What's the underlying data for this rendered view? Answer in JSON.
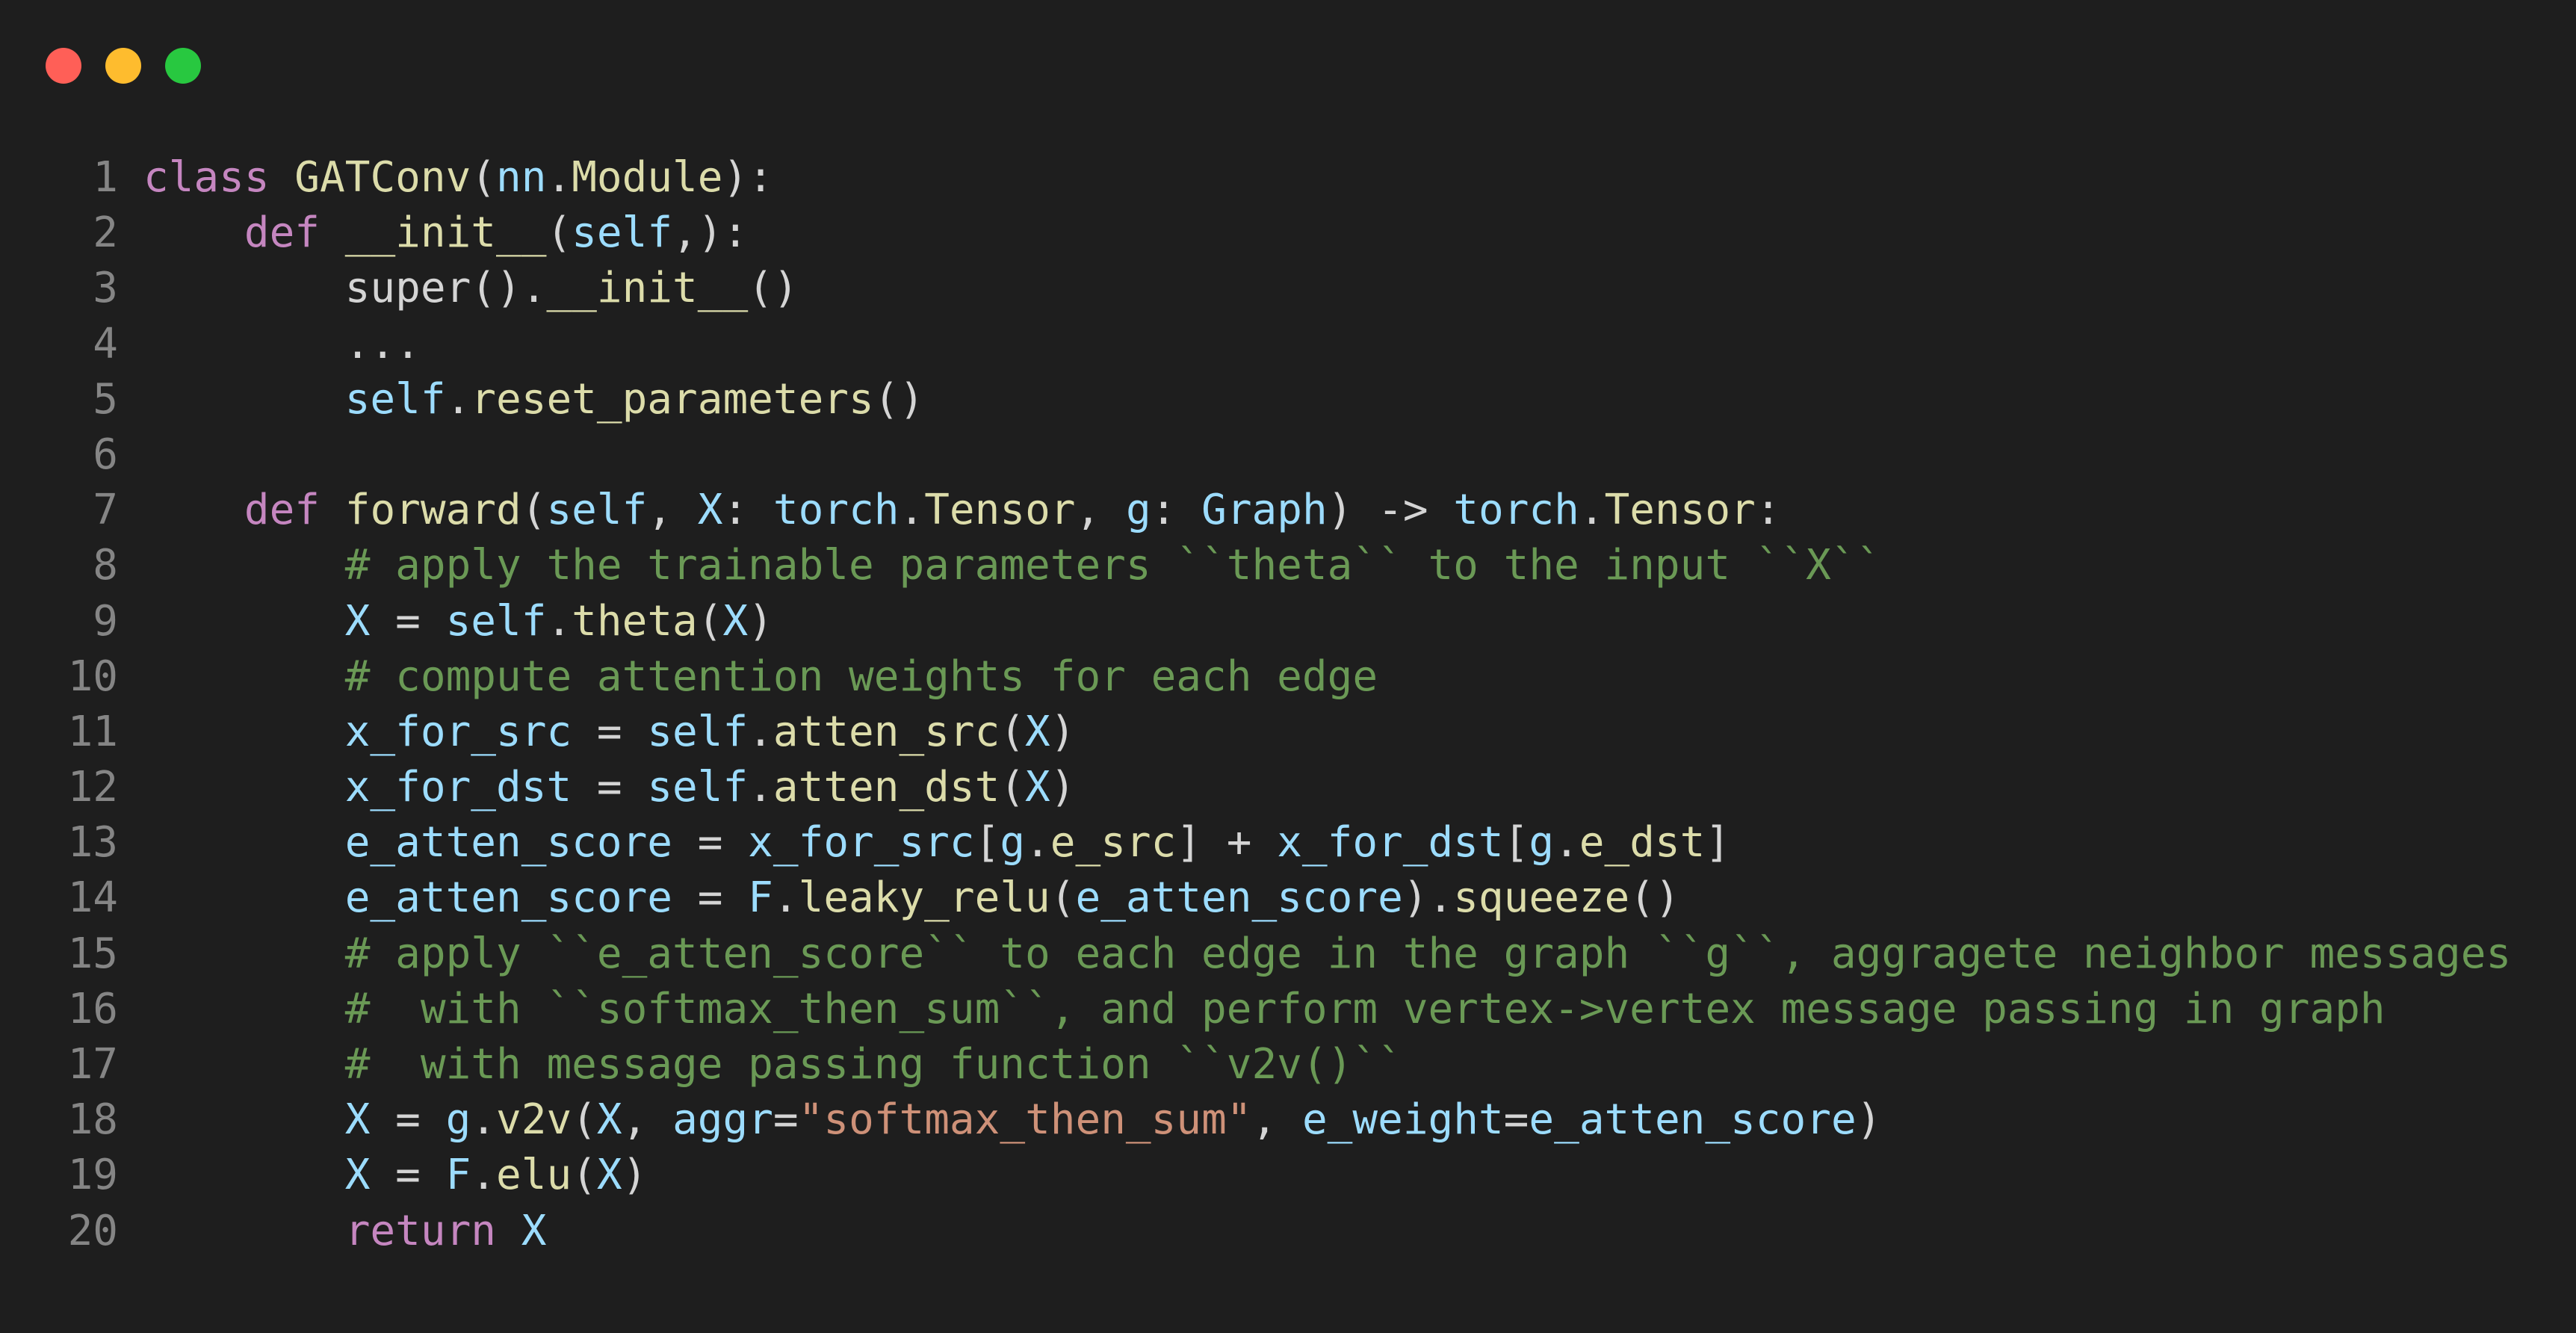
{
  "window": {
    "controls": [
      {
        "name": "close",
        "color": "#ff5f57"
      },
      {
        "name": "minimize",
        "color": "#febc2e"
      },
      {
        "name": "maximize",
        "color": "#28c840"
      }
    ]
  },
  "editor": {
    "language": "python",
    "lines": [
      {
        "n": "1",
        "tokens": [
          [
            "kw",
            "class"
          ],
          [
            "plain",
            " "
          ],
          [
            "cls",
            "GATConv"
          ],
          [
            "plain",
            "("
          ],
          [
            "var",
            "nn"
          ],
          [
            "plain",
            "."
          ],
          [
            "cls",
            "Module"
          ],
          [
            "plain",
            "):"
          ]
        ]
      },
      {
        "n": "2",
        "tokens": [
          [
            "plain",
            "    "
          ],
          [
            "def",
            "def"
          ],
          [
            "plain",
            " "
          ],
          [
            "fn",
            "__init__"
          ],
          [
            "plain",
            "("
          ],
          [
            "self",
            "self"
          ],
          [
            "plain",
            ",):"
          ]
        ]
      },
      {
        "n": "3",
        "tokens": [
          [
            "plain",
            "        super()."
          ],
          [
            "fn",
            "__init__"
          ],
          [
            "plain",
            "()"
          ]
        ]
      },
      {
        "n": "4",
        "tokens": [
          [
            "plain",
            "        ..."
          ]
        ]
      },
      {
        "n": "5",
        "tokens": [
          [
            "plain",
            "        "
          ],
          [
            "self",
            "self"
          ],
          [
            "plain",
            "."
          ],
          [
            "fn",
            "reset_parameters"
          ],
          [
            "plain",
            "()"
          ]
        ]
      },
      {
        "n": "6",
        "tokens": [
          [
            "plain",
            ""
          ]
        ]
      },
      {
        "n": "7",
        "tokens": [
          [
            "plain",
            "    "
          ],
          [
            "def",
            "def"
          ],
          [
            "plain",
            " "
          ],
          [
            "fn",
            "forward"
          ],
          [
            "plain",
            "("
          ],
          [
            "self",
            "self"
          ],
          [
            "plain",
            ", "
          ],
          [
            "var",
            "X"
          ],
          [
            "plain",
            ": "
          ],
          [
            "var",
            "torch"
          ],
          [
            "plain",
            "."
          ],
          [
            "cls",
            "Tensor"
          ],
          [
            "plain",
            ", "
          ],
          [
            "var",
            "g"
          ],
          [
            "plain",
            ": "
          ],
          [
            "var",
            "Graph"
          ],
          [
            "plain",
            ") -> "
          ],
          [
            "var",
            "torch"
          ],
          [
            "plain",
            "."
          ],
          [
            "cls",
            "Tensor"
          ],
          [
            "plain",
            ":"
          ]
        ]
      },
      {
        "n": "8",
        "tokens": [
          [
            "plain",
            "        "
          ],
          [
            "cm",
            "# apply the trainable parameters ``theta`` to the input ``X``"
          ]
        ]
      },
      {
        "n": "9",
        "tokens": [
          [
            "plain",
            "        "
          ],
          [
            "var",
            "X"
          ],
          [
            "plain",
            " = "
          ],
          [
            "self",
            "self"
          ],
          [
            "plain",
            "."
          ],
          [
            "fn",
            "theta"
          ],
          [
            "plain",
            "("
          ],
          [
            "var",
            "X"
          ],
          [
            "plain",
            ")"
          ]
        ]
      },
      {
        "n": "10",
        "tokens": [
          [
            "plain",
            "        "
          ],
          [
            "cm",
            "# compute attention weights for each edge"
          ]
        ]
      },
      {
        "n": "11",
        "tokens": [
          [
            "plain",
            "        "
          ],
          [
            "var",
            "x_for_src"
          ],
          [
            "plain",
            " = "
          ],
          [
            "self",
            "self"
          ],
          [
            "plain",
            "."
          ],
          [
            "fn",
            "atten_src"
          ],
          [
            "plain",
            "("
          ],
          [
            "var",
            "X"
          ],
          [
            "plain",
            ")"
          ]
        ]
      },
      {
        "n": "12",
        "tokens": [
          [
            "plain",
            "        "
          ],
          [
            "var",
            "x_for_dst"
          ],
          [
            "plain",
            " = "
          ],
          [
            "self",
            "self"
          ],
          [
            "plain",
            "."
          ],
          [
            "fn",
            "atten_dst"
          ],
          [
            "plain",
            "("
          ],
          [
            "var",
            "X"
          ],
          [
            "plain",
            ")"
          ]
        ]
      },
      {
        "n": "13",
        "tokens": [
          [
            "plain",
            "        "
          ],
          [
            "var",
            "e_atten_score"
          ],
          [
            "plain",
            " = "
          ],
          [
            "var",
            "x_for_src"
          ],
          [
            "plain",
            "["
          ],
          [
            "var",
            "g"
          ],
          [
            "plain",
            "."
          ],
          [
            "fn",
            "e_src"
          ],
          [
            "plain",
            "] + "
          ],
          [
            "var",
            "x_for_dst"
          ],
          [
            "plain",
            "["
          ],
          [
            "var",
            "g"
          ],
          [
            "plain",
            "."
          ],
          [
            "fn",
            "e_dst"
          ],
          [
            "plain",
            "]"
          ]
        ]
      },
      {
        "n": "14",
        "tokens": [
          [
            "plain",
            "        "
          ],
          [
            "var",
            "e_atten_score"
          ],
          [
            "plain",
            " = "
          ],
          [
            "var",
            "F"
          ],
          [
            "plain",
            "."
          ],
          [
            "fn",
            "leaky_relu"
          ],
          [
            "plain",
            "("
          ],
          [
            "var",
            "e_atten_score"
          ],
          [
            "plain",
            ")."
          ],
          [
            "fn",
            "squeeze"
          ],
          [
            "plain",
            "()"
          ]
        ]
      },
      {
        "n": "15",
        "tokens": [
          [
            "plain",
            "        "
          ],
          [
            "cm",
            "# apply ``e_atten_score`` to each edge in the graph ``g``, aggragete neighbor messages"
          ]
        ]
      },
      {
        "n": "16",
        "tokens": [
          [
            "plain",
            "        "
          ],
          [
            "cm",
            "#  with ``softmax_then_sum``, and perform vertex->vertex message passing in graph"
          ]
        ]
      },
      {
        "n": "17",
        "tokens": [
          [
            "plain",
            "        "
          ],
          [
            "cm",
            "#  with message passing function ``v2v()``"
          ]
        ]
      },
      {
        "n": "18",
        "tokens": [
          [
            "plain",
            "        "
          ],
          [
            "var",
            "X"
          ],
          [
            "plain",
            " = "
          ],
          [
            "var",
            "g"
          ],
          [
            "plain",
            "."
          ],
          [
            "fn",
            "v2v"
          ],
          [
            "plain",
            "("
          ],
          [
            "var",
            "X"
          ],
          [
            "plain",
            ", "
          ],
          [
            "var",
            "aggr"
          ],
          [
            "plain",
            "="
          ],
          [
            "str",
            "\"softmax_then_sum\""
          ],
          [
            "plain",
            ", "
          ],
          [
            "var",
            "e_weight"
          ],
          [
            "plain",
            "="
          ],
          [
            "var",
            "e_atten_score"
          ],
          [
            "plain",
            ")"
          ]
        ]
      },
      {
        "n": "19",
        "tokens": [
          [
            "plain",
            "        "
          ],
          [
            "var",
            "X"
          ],
          [
            "plain",
            " = "
          ],
          [
            "var",
            "F"
          ],
          [
            "plain",
            "."
          ],
          [
            "fn",
            "elu"
          ],
          [
            "plain",
            "("
          ],
          [
            "var",
            "X"
          ],
          [
            "plain",
            ")"
          ]
        ]
      },
      {
        "n": "20",
        "tokens": [
          [
            "plain",
            "        "
          ],
          [
            "kw",
            "return"
          ],
          [
            "plain",
            " "
          ],
          [
            "var",
            "X"
          ]
        ]
      }
    ]
  }
}
